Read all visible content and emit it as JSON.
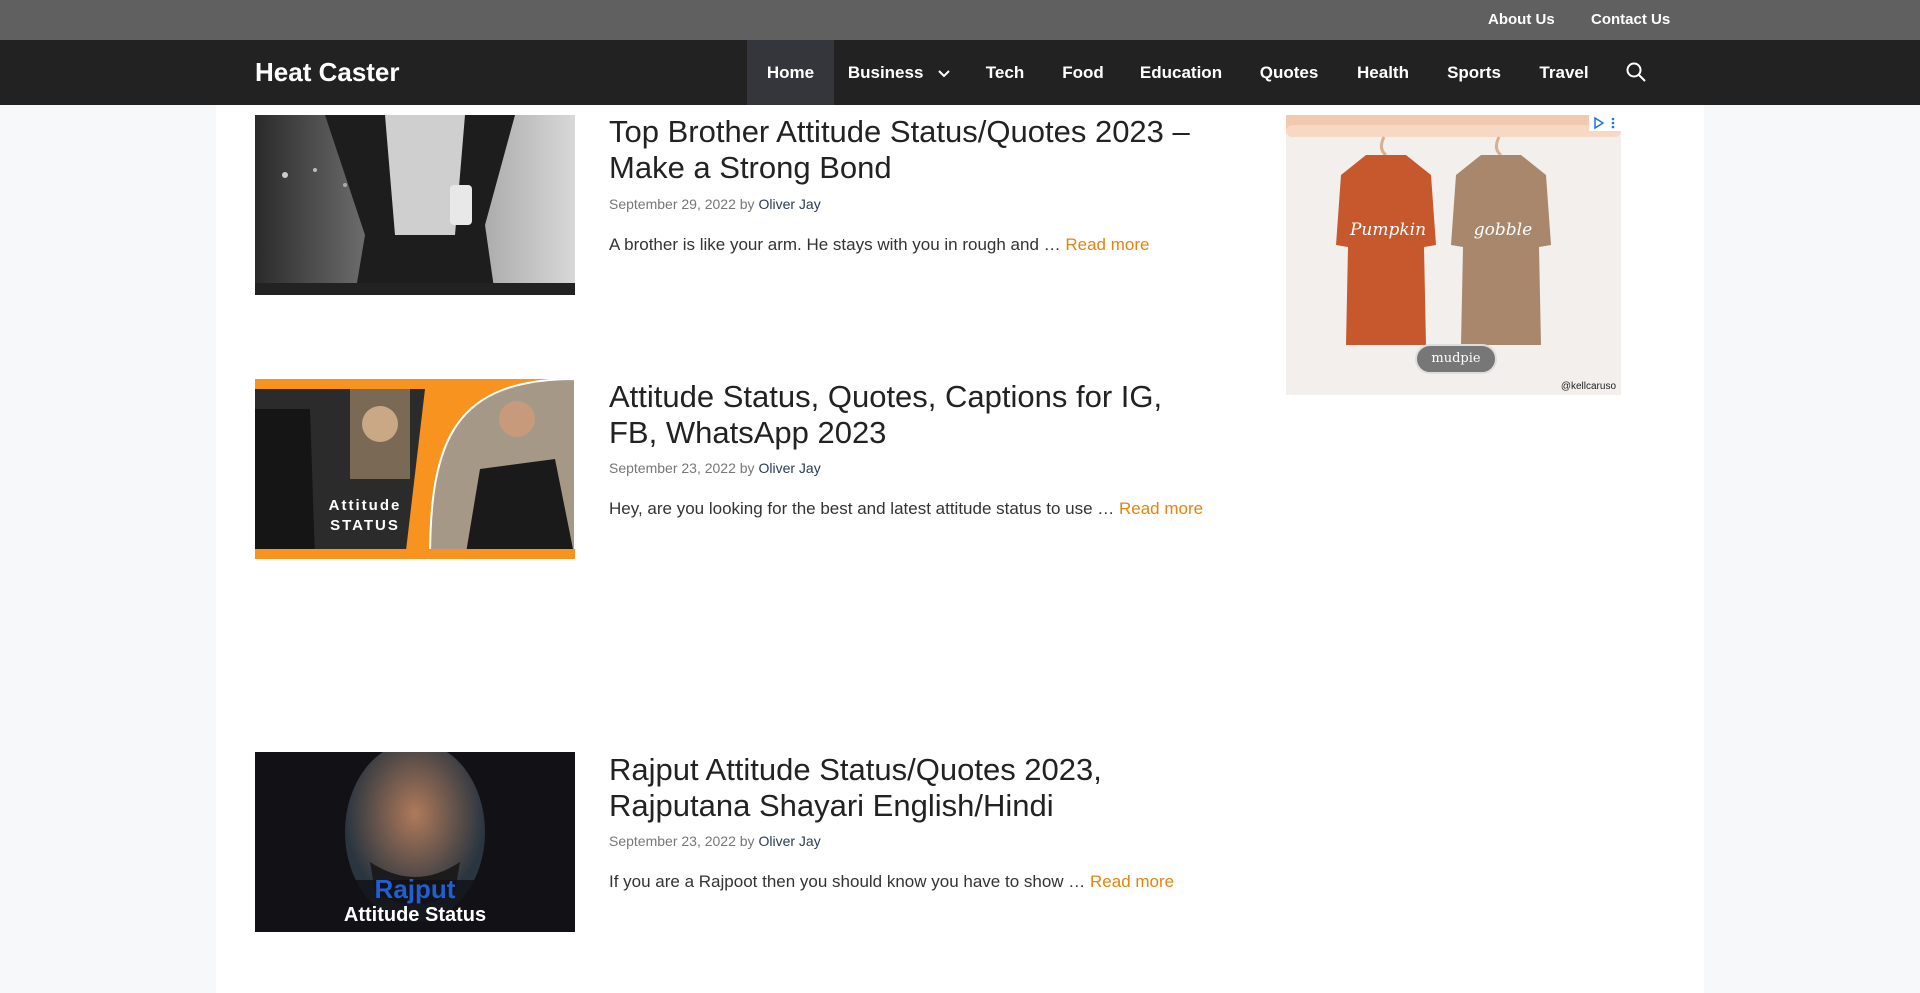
{
  "topbar": {
    "links": [
      "About Us",
      "Contact Us"
    ]
  },
  "nav": {
    "brand": "Heat Caster",
    "items": [
      "Home",
      "Business",
      "Tech",
      "Food",
      "Education",
      "Quotes",
      "Health",
      "Sports",
      "Travel"
    ],
    "active": "Home",
    "search_icon": "search-icon"
  },
  "posts": [
    {
      "title": "Top Brother Attitude Status/Quotes 2023 – Make a Strong Bond",
      "date": "September 29, 2022",
      "by": "by",
      "author": "Oliver Jay",
      "excerpt": "A brother is like your arm. He stays with you in rough and … ",
      "read_more": "Read more"
    },
    {
      "title": "Attitude Status, Quotes, Captions for IG, FB, WhatsApp 2023",
      "date": "September 23, 2022",
      "by": "by",
      "author": "Oliver Jay",
      "excerpt": "Hey, are you looking for the best and latest attitude status to use … ",
      "read_more": "Read more",
      "thumb_text": [
        "Attitude",
        "STATUS"
      ]
    },
    {
      "title": "Rajput Attitude Status/Quotes 2023, Rajputana Shayari English/Hindi",
      "date": "September 23, 2022",
      "by": "by",
      "author": "Oliver Jay",
      "excerpt": "If you are a Rajpoot then you should know you have to show … ",
      "read_more": "Read more",
      "thumb_text": [
        "Rajput",
        "Attitude Status"
      ]
    }
  ],
  "ad": {
    "brand": "mudpie",
    "credit": "@kellcaruso",
    "sweater_texts": [
      "Pumpkin",
      "gobble"
    ]
  },
  "colors": {
    "topbar": "#606060",
    "navbar": "#222222",
    "accent": "#e5830f",
    "author": "#2a3b52"
  }
}
